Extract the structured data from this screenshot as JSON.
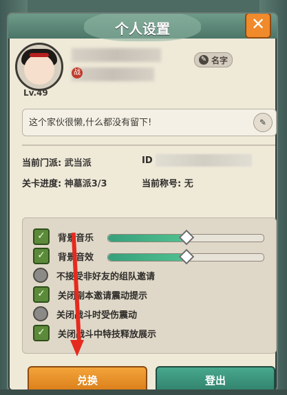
{
  "title": "个人设置",
  "close_icon": "✕",
  "level": "Lv.49",
  "name_button": "名字",
  "signature": "这个家伙很懒,什么都没有留下!",
  "info": {
    "faction_label": "当前门派:",
    "faction_value": "武当派",
    "id_label": "ID",
    "progress_label": "关卡进度:",
    "progress_value": "神墓派3/3",
    "title_label": "当前称号:",
    "title_value": "无"
  },
  "settings": [
    {
      "label": "背景音乐",
      "type": "checkbox",
      "checked": true,
      "slider": 0.5
    },
    {
      "label": "背景音效",
      "type": "checkbox",
      "checked": true,
      "slider": 0.5
    },
    {
      "label": "不接受非好友的组队邀请",
      "type": "radio",
      "checked": false
    },
    {
      "label": "关闭副本邀请震动提示",
      "type": "checkbox",
      "checked": true
    },
    {
      "label": "关闭战斗时受伤震动",
      "type": "radio",
      "checked": false
    },
    {
      "label": "关闭战斗中特技释放展示",
      "type": "checkbox",
      "checked": true
    }
  ],
  "buttons": {
    "exchange": "兑换",
    "logout": "登出"
  },
  "colors": {
    "accent": "#37a07c",
    "orange": "#f08a2a",
    "arrow": "#e52b1f"
  }
}
